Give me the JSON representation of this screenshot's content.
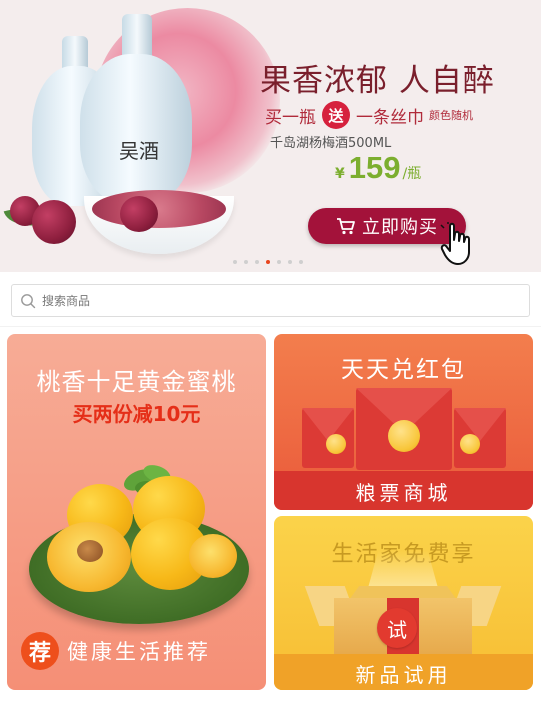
{
  "banner": {
    "headline": "果香浓郁 人自醉",
    "promo_before": "买一瓶",
    "promo_badge": "送",
    "promo_after": "一条丝巾",
    "promo_note": "颜色随机",
    "product_name": "千岛湖杨梅酒500ML",
    "price_currency": "¥",
    "price_amount": "159",
    "price_unit": "/瓶",
    "bottle_label": "吴酒",
    "buy_label": "立即购买",
    "carousel_count": 7,
    "carousel_active_index": 3
  },
  "search": {
    "placeholder": "搜索商品"
  },
  "tiles": {
    "peach": {
      "title": "桃香十足黄金蜜桃",
      "subtitle": "买两份减10元",
      "badge": "荐",
      "footer": "健康生活推荐"
    },
    "redpacket": {
      "title": "天天兑红包",
      "footer": "粮票商城"
    },
    "trial": {
      "title": "生活家免费享",
      "badge": "试",
      "footer": "新品试用"
    }
  },
  "colors": {
    "brand_red": "#a3123a",
    "carousel_active": "#e8451e",
    "price_green": "#7cae2f"
  }
}
